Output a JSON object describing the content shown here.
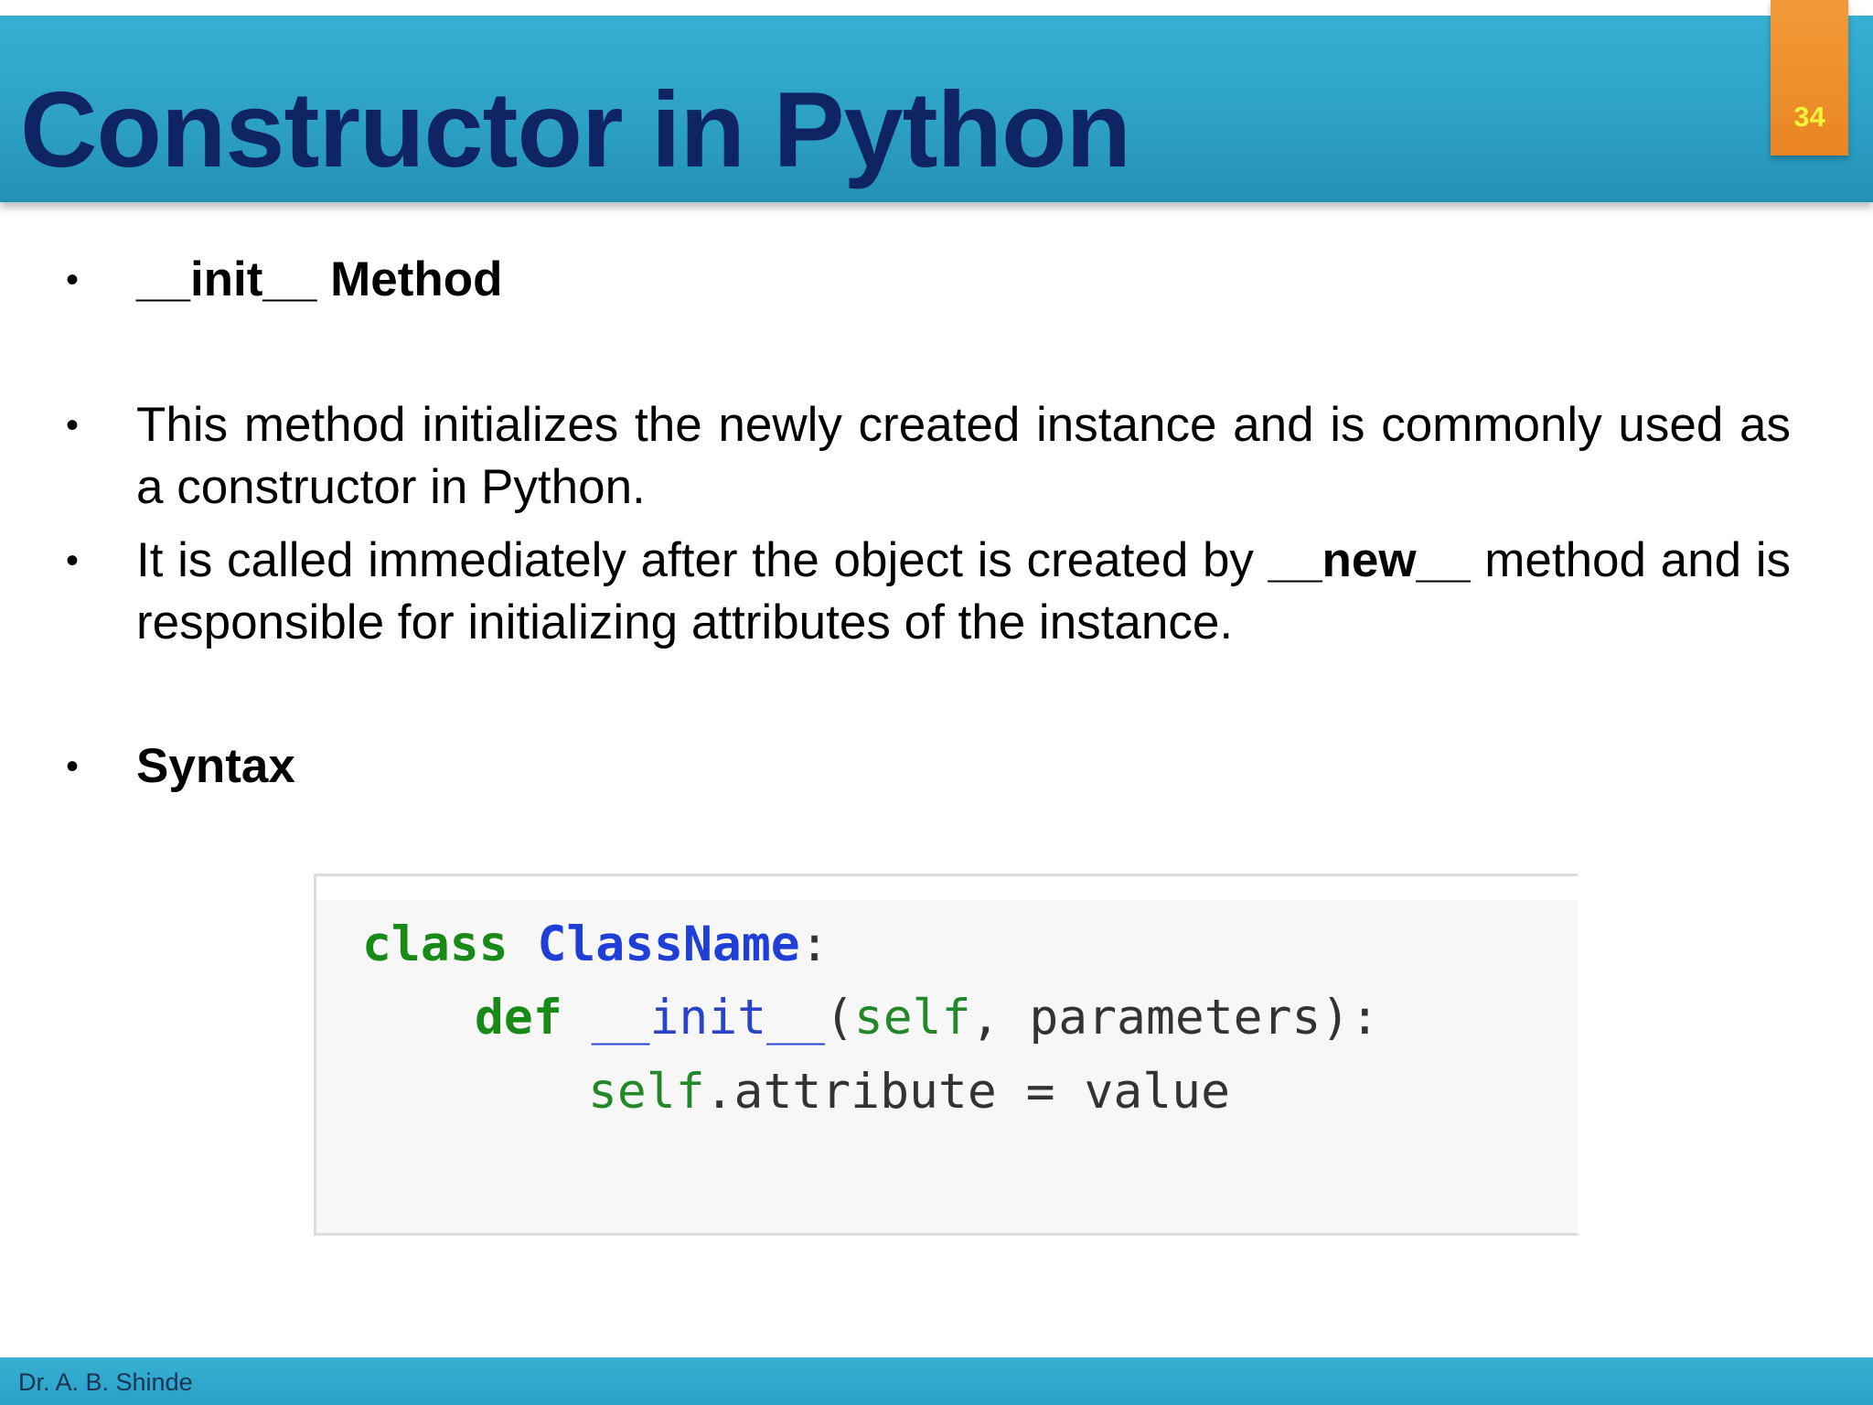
{
  "slide": {
    "title": "Constructor in Python",
    "page_number": "34"
  },
  "bullets": [
    {
      "text": "__init__ Method"
    },
    {
      "text": "This method initializes the newly created instance and is commonly used as a constructor in Python."
    },
    {
      "text_before": "It is called immediately after the object is created by",
      "bold_text": "__new__",
      "text_after": "method and is responsible for initializing attributes of the instance."
    },
    {
      "text": "Syntax"
    }
  ],
  "code": {
    "line1": {
      "keyword": "class",
      "class_name": "ClassName",
      "colon": ":"
    },
    "line2": {
      "keyword": "def",
      "method": "__init__",
      "params_open": "(",
      "self_param": "self",
      "rest": ", parameters):"
    },
    "line3": {
      "self_ref": "self",
      "rest": ".attribute = value"
    }
  },
  "footer": {
    "author": "Dr. A. B. Shinde"
  },
  "colors": {
    "header_blue": "#2c9fc4",
    "title_navy": "#0f2463",
    "badge_orange": "#ea8523",
    "badge_text_yellow": "#f7f23a",
    "code_keyword_green": "#178a17",
    "code_class_blue": "#1f3fd6"
  }
}
